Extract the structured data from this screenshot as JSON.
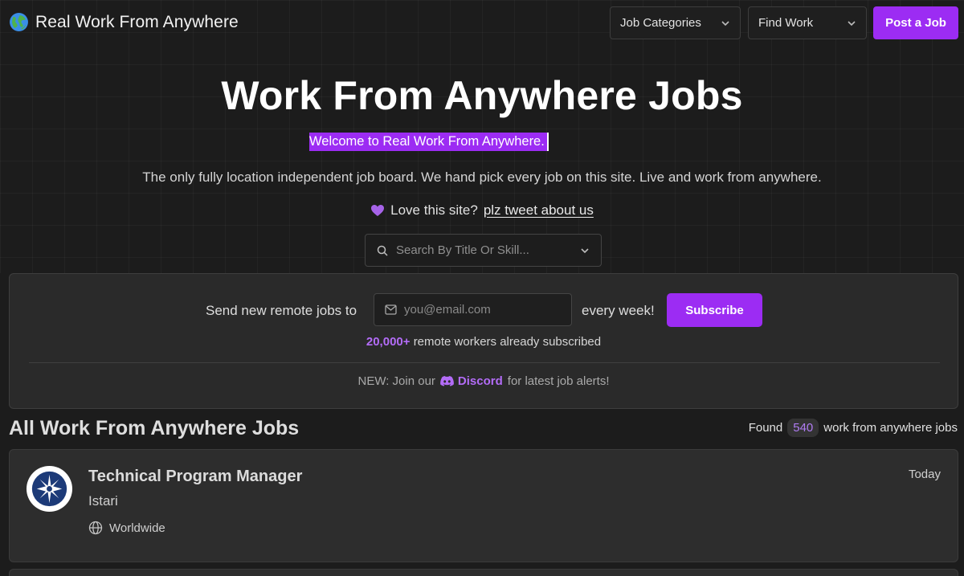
{
  "header": {
    "brand": "Real Work From Anywhere",
    "nav": [
      {
        "label": "Job Categories"
      },
      {
        "label": "Find Work"
      }
    ],
    "post_label": "Post a Job"
  },
  "hero": {
    "title": "Work From Anywhere Jobs",
    "welcome": "Welcome to Real Work From Anywhere.",
    "tagline": "The only fully location independent job board. We hand pick every job on this site. Live and work from anywhere.",
    "love_text": "Love this site?",
    "tweet_link": "plz tweet about us",
    "search_placeholder": "Search By Title Or Skill..."
  },
  "subscribe": {
    "lead": "Send new remote jobs to",
    "email_placeholder": "you@email.com",
    "trail": "every week!",
    "button": "Subscribe",
    "count": "20,000+",
    "count_text": "remote workers already subscribed",
    "discord_prefix": "NEW: Join our",
    "discord_link": "Discord",
    "discord_suffix": "for latest job alerts!"
  },
  "jobs": {
    "heading": "All Work From Anywhere Jobs",
    "found_prefix": "Found",
    "found_count": "540",
    "found_suffix": "work from anywhere jobs",
    "items": [
      {
        "title": "Technical Program Manager",
        "company": "Istari",
        "location": "Worldwide",
        "date": "Today"
      }
    ]
  },
  "colors": {
    "accent": "#9c2cf3",
    "accent_text": "#b36cf7",
    "background": "#1c1c1c",
    "card": "#2d2d2d"
  }
}
